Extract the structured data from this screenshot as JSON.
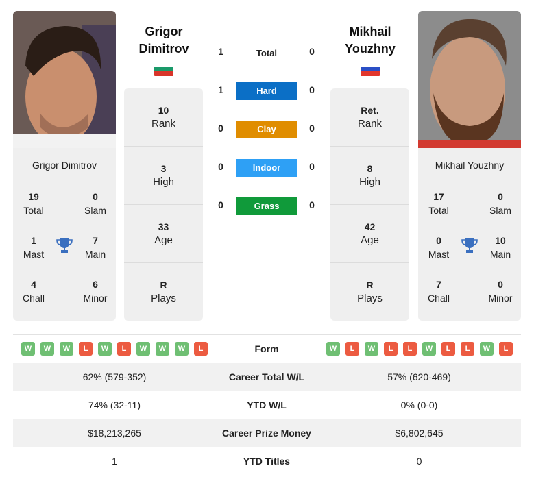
{
  "colors": {
    "hard": "#0b6fc6",
    "clay": "#e08d00",
    "indoor": "#2ea0f5",
    "grass": "#109a3a",
    "win": "#6fbf73",
    "loss": "#ec5b41",
    "trophy": "#3a6fbf"
  },
  "player1": {
    "name_line1": "Grigor",
    "name_line2": "Dimitrov",
    "full_name": "Grigor Dimitrov",
    "flag": "bulgaria-flag",
    "flag_colors": [
      "#ffffff",
      "#1a9a6a",
      "#d8352a"
    ],
    "titles": {
      "total": {
        "value": "19",
        "label": "Total"
      },
      "slam": {
        "value": "0",
        "label": "Slam"
      },
      "mast": {
        "value": "1",
        "label": "Mast"
      },
      "main": {
        "value": "7",
        "label": "Main"
      },
      "chall": {
        "value": "4",
        "label": "Chall"
      },
      "minor": {
        "value": "6",
        "label": "Minor"
      }
    },
    "stats": [
      {
        "value": "10",
        "label": "Rank"
      },
      {
        "value": "3",
        "label": "High"
      },
      {
        "value": "33",
        "label": "Age"
      },
      {
        "value": "R",
        "label": "Plays"
      }
    ]
  },
  "player2": {
    "name_line1": "Mikhail",
    "name_line2": "Youzhny",
    "full_name": "Mikhail Youzhny",
    "flag": "russia-flag",
    "flag_colors": [
      "#ffffff",
      "#2a4fc6",
      "#e2362c"
    ],
    "titles": {
      "total": {
        "value": "17",
        "label": "Total"
      },
      "slam": {
        "value": "0",
        "label": "Slam"
      },
      "mast": {
        "value": "0",
        "label": "Mast"
      },
      "main": {
        "value": "10",
        "label": "Main"
      },
      "chall": {
        "value": "7",
        "label": "Chall"
      },
      "minor": {
        "value": "0",
        "label": "Minor"
      }
    },
    "stats": [
      {
        "value": "Ret.",
        "label": "Rank"
      },
      {
        "value": "8",
        "label": "High"
      },
      {
        "value": "42",
        "label": "Age"
      },
      {
        "value": "R",
        "label": "Plays"
      }
    ]
  },
  "h2h": {
    "total": {
      "label": "Total",
      "left": "1",
      "right": "0"
    },
    "surfaces": [
      {
        "label": "Hard",
        "left": "1",
        "right": "0"
      },
      {
        "label": "Clay",
        "left": "0",
        "right": "0"
      },
      {
        "label": "Indoor",
        "left": "0",
        "right": "0"
      },
      {
        "label": "Grass",
        "left": "0",
        "right": "0"
      }
    ]
  },
  "table": {
    "form_label": "Form",
    "form_left": [
      "W",
      "W",
      "W",
      "L",
      "W",
      "L",
      "W",
      "W",
      "W",
      "L"
    ],
    "form_right": [
      "W",
      "L",
      "W",
      "L",
      "L",
      "W",
      "L",
      "L",
      "W",
      "L"
    ],
    "rows": [
      {
        "label": "Career Total W/L",
        "left": "62% (579-352)",
        "right": "57% (620-469)"
      },
      {
        "label": "YTD W/L",
        "left": "74% (32-11)",
        "right": "0% (0-0)"
      },
      {
        "label": "Career Prize Money",
        "left": "$18,213,265",
        "right": "$6,802,645"
      },
      {
        "label": "YTD Titles",
        "left": "1",
        "right": "0"
      }
    ]
  }
}
